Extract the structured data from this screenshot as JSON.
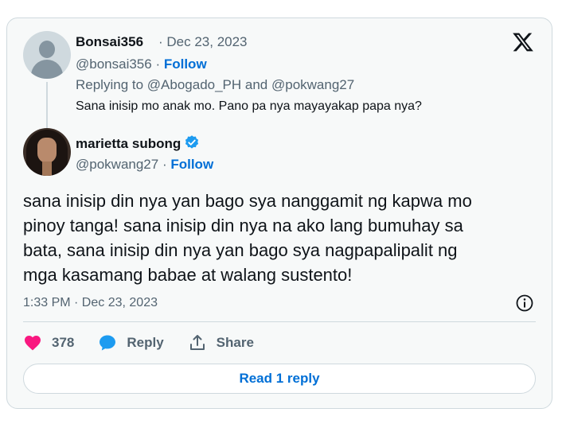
{
  "parent_tweet": {
    "display_name": "Bonsai356",
    "date": "· Dec 23, 2023",
    "handle": "@bonsai356 ·",
    "follow_label": "Follow",
    "replying_to": "Replying to @Abogado_PH and @pokwang27",
    "text": "Sana inisip mo anak mo. Pano pa nya mayayakap papa nya?"
  },
  "main_tweet": {
    "display_name": "marietta subong",
    "verified": true,
    "handle": "@pokwang27 ·",
    "follow_label": "Follow",
    "text": "sana inisip din nya yan bago sya nanggamit ng kapwa mo\npinoy tanga! sana inisip din nya na ako lang bumuhay sa\nbata, sana inisip din nya yan bago sya nagpapalipalit ng\nmga kasamang babae at walang sustento!",
    "timestamp": "1:33 PM · Dec 23, 2023"
  },
  "actions": {
    "like_count": "378",
    "reply_label": "Reply",
    "share_label": "Share"
  },
  "read_replies_label": "Read 1 reply",
  "icons": {
    "brand": "x-logo-icon",
    "like": "heart-icon",
    "reply": "speech-bubble-icon",
    "share": "share-icon",
    "info": "info-icon",
    "verified": "verified-badge-icon"
  },
  "colors": {
    "like": "#f91880",
    "reply": "#1d9bf0",
    "link": "#006fd6",
    "verified": "#1d9bf0"
  }
}
